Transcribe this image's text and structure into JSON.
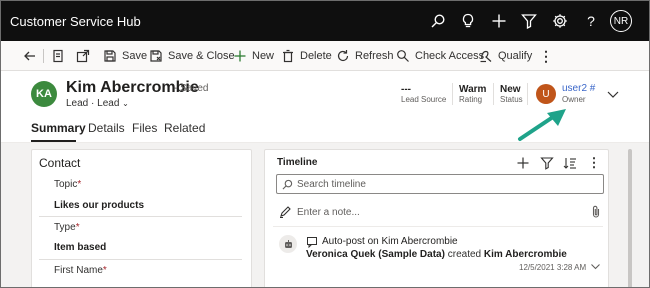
{
  "app": {
    "title": "Customer Service Hub",
    "user_initials": "NR"
  },
  "topbar_icons": [
    "search-icon",
    "lightbulb-icon",
    "plus-icon",
    "filter-icon",
    "gear-icon",
    "help-icon"
  ],
  "commands": {
    "save": "Save",
    "save_close": "Save & Close",
    "new": "New",
    "delete": "Delete",
    "refresh": "Refresh",
    "check_access": "Check Access",
    "qualify": "Qualify"
  },
  "record": {
    "initials": "KA",
    "name": "Kim Abercrombie",
    "saved_state": "- Saved",
    "entity": "Lead",
    "form": "Lead",
    "avatar_color": "#3c8a3e"
  },
  "header_fields": [
    {
      "value": "---",
      "label": "Lead Source"
    },
    {
      "value": "Warm",
      "label": "Rating"
    },
    {
      "value": "New",
      "label": "Status"
    }
  ],
  "owner": {
    "initial": "U",
    "name": "user2 #",
    "label": "Owner",
    "avatar_color": "#c0551a",
    "link_color": "#3b67c9"
  },
  "tabs": [
    {
      "label": "Summary",
      "active": true
    },
    {
      "label": "Details",
      "active": false
    },
    {
      "label": "Files",
      "active": false
    },
    {
      "label": "Related",
      "active": false
    }
  ],
  "contact": {
    "title": "Contact",
    "fields": [
      {
        "label": "Topic",
        "required": "*",
        "value": "Likes our products"
      },
      {
        "label": "Type",
        "required": "*",
        "value": "Item based"
      },
      {
        "label": "First Name",
        "required": "*",
        "value": ""
      }
    ]
  },
  "timeline": {
    "title": "Timeline",
    "search_placeholder": "Search timeline",
    "note_placeholder": "Enter a note...",
    "posts": [
      {
        "title": "Auto-post on Kim Abercrombie",
        "author": "Veronica Quek (Sample Data)",
        "action": "created",
        "target": "Kim Abercrombie",
        "timestamp": "12/5/2021 3:28 AM"
      }
    ]
  },
  "colors": {
    "accent_arrow": "#1fa38a",
    "topbar_bg": "#0f0f0f"
  }
}
